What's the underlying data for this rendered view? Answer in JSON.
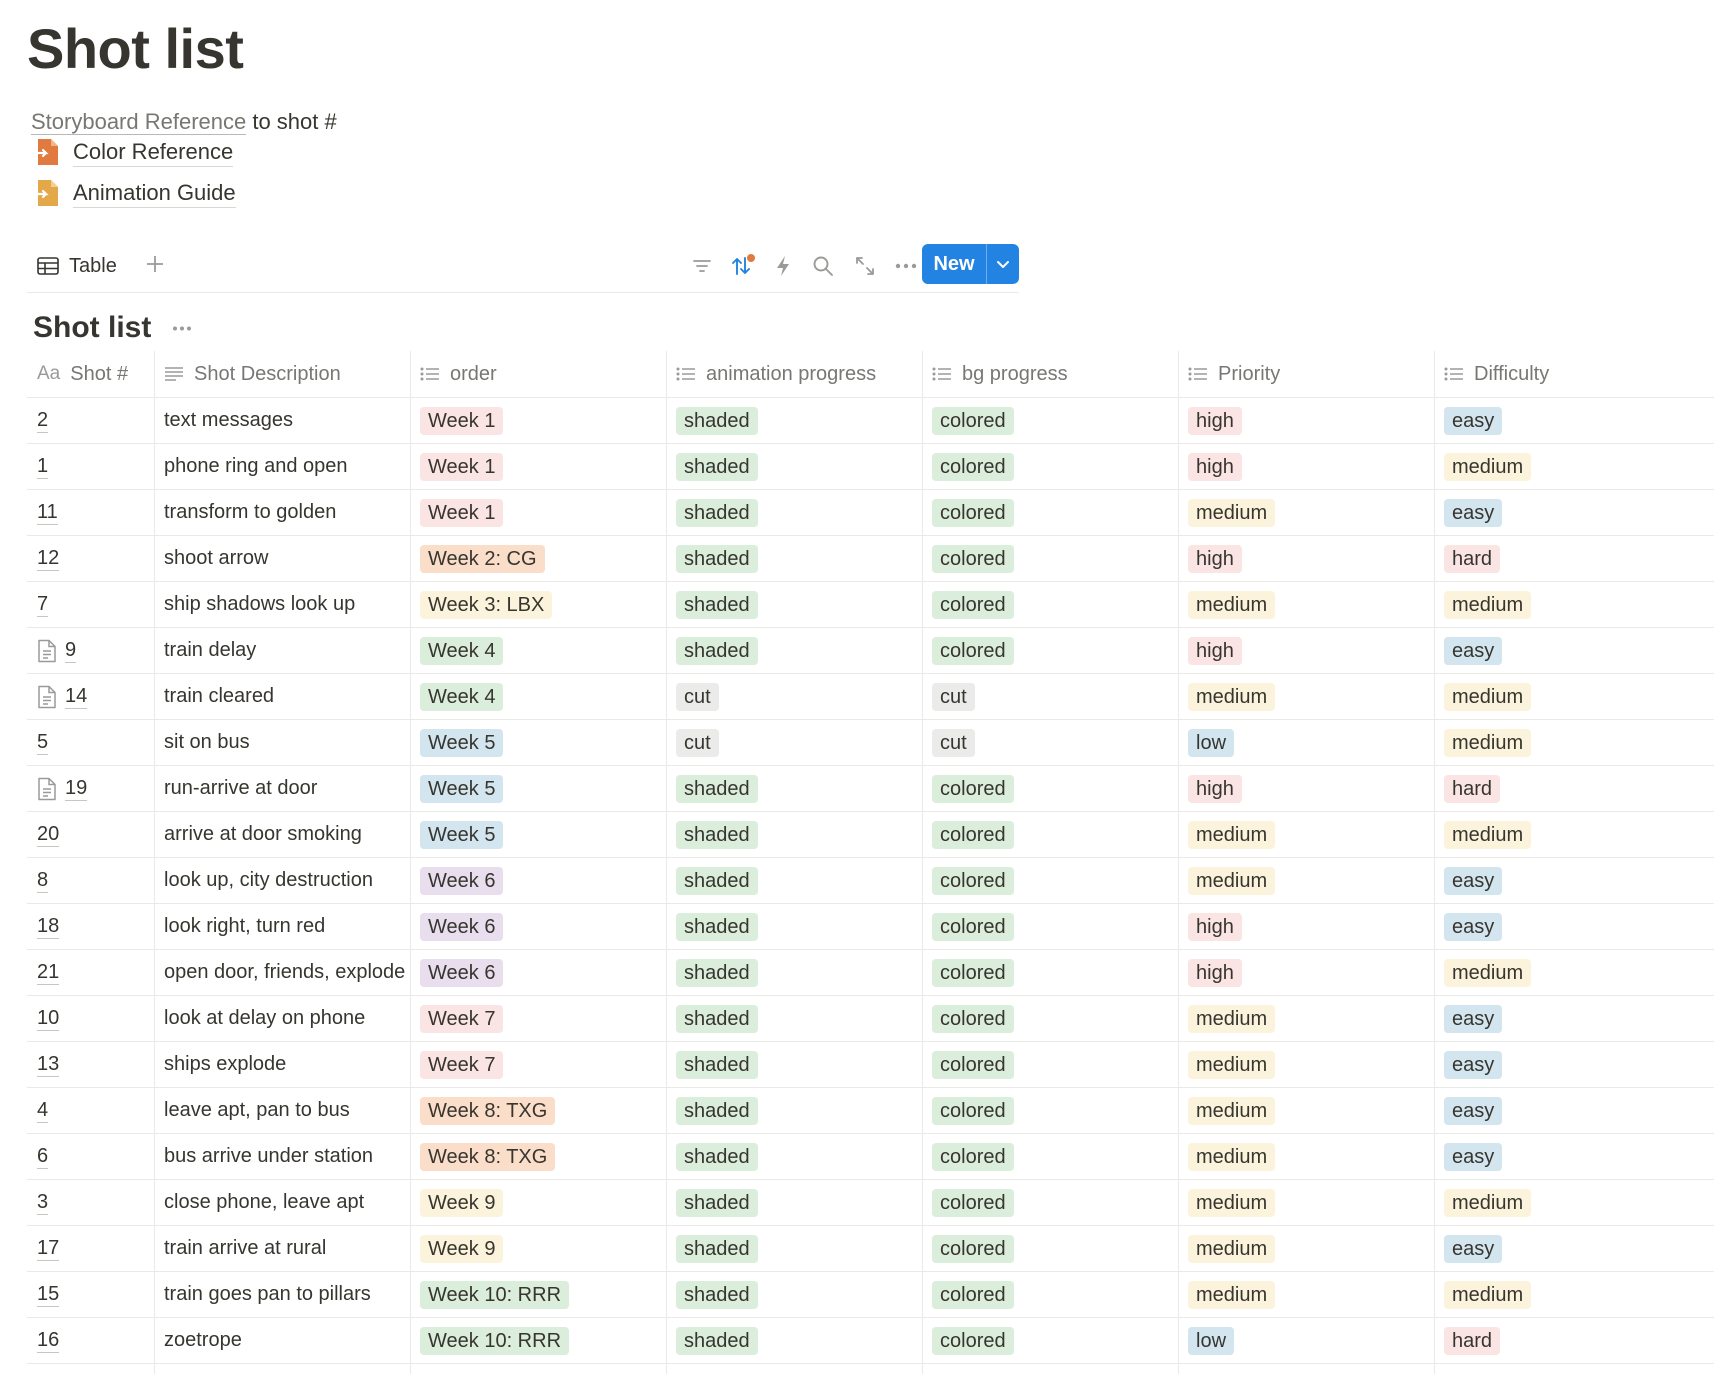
{
  "page": {
    "title": "Shot list"
  },
  "intro": {
    "link_text": "Storyboard Reference",
    "rest_text": " to shot #"
  },
  "page_links": [
    {
      "label": "Color Reference",
      "icon": "document-arrow-icon"
    },
    {
      "label": "Animation Guide",
      "icon": "document-arrow-icon"
    }
  ],
  "view": {
    "tab_label": "Table",
    "new_label": "New"
  },
  "database": {
    "title": "Shot list"
  },
  "colors": {
    "accent": "#2383e2",
    "red": "#fbe4e4",
    "orange": "#fadec9",
    "yellow": "#fbf3db",
    "green": "#dbeddb",
    "blue": "#d3e5ef",
    "purple": "#e8deee",
    "gray": "#ebebea",
    "sort_dot": "#e07a3e",
    "doc_icon": "#e07a3e"
  },
  "columns": [
    {
      "key": "shot",
      "label": "Shot #",
      "icon": "title-aa-icon"
    },
    {
      "key": "desc",
      "label": "Shot Description",
      "icon": "text-lines-icon"
    },
    {
      "key": "order",
      "label": "order",
      "icon": "list-icon"
    },
    {
      "key": "anim",
      "label": "animation progress",
      "icon": "list-icon"
    },
    {
      "key": "bg",
      "label": "bg progress",
      "icon": "list-icon"
    },
    {
      "key": "priority",
      "label": "Priority",
      "icon": "list-icon"
    },
    {
      "key": "difficulty",
      "label": "Difficulty",
      "icon": "list-icon"
    }
  ],
  "title_icon_text": "Aa",
  "rows": [
    {
      "shot": "2",
      "page": false,
      "desc": "text messages",
      "order": [
        "Week 1",
        "red"
      ],
      "anim": [
        "shaded",
        "green"
      ],
      "bg": [
        "colored",
        "green"
      ],
      "priority": [
        "high",
        "red"
      ],
      "difficulty": [
        "easy",
        "blue"
      ]
    },
    {
      "shot": "1",
      "page": false,
      "desc": "phone ring and open",
      "order": [
        "Week 1",
        "red"
      ],
      "anim": [
        "shaded",
        "green"
      ],
      "bg": [
        "colored",
        "green"
      ],
      "priority": [
        "high",
        "red"
      ],
      "difficulty": [
        "medium",
        "yellow"
      ]
    },
    {
      "shot": "11",
      "page": false,
      "desc": "transform to golden",
      "order": [
        "Week 1",
        "red"
      ],
      "anim": [
        "shaded",
        "green"
      ],
      "bg": [
        "colored",
        "green"
      ],
      "priority": [
        "medium",
        "yellow"
      ],
      "difficulty": [
        "easy",
        "blue"
      ]
    },
    {
      "shot": "12",
      "page": false,
      "desc": "shoot arrow",
      "order": [
        "Week 2: CG",
        "orange"
      ],
      "anim": [
        "shaded",
        "green"
      ],
      "bg": [
        "colored",
        "green"
      ],
      "priority": [
        "high",
        "red"
      ],
      "difficulty": [
        "hard",
        "red"
      ]
    },
    {
      "shot": "7",
      "page": false,
      "desc": "ship shadows look up",
      "order": [
        "Week 3: LBX",
        "yellow"
      ],
      "anim": [
        "shaded",
        "green"
      ],
      "bg": [
        "colored",
        "green"
      ],
      "priority": [
        "medium",
        "yellow"
      ],
      "difficulty": [
        "medium",
        "yellow"
      ]
    },
    {
      "shot": "9",
      "page": true,
      "desc": "train delay",
      "order": [
        "Week 4",
        "green"
      ],
      "anim": [
        "shaded",
        "green"
      ],
      "bg": [
        "colored",
        "green"
      ],
      "priority": [
        "high",
        "red"
      ],
      "difficulty": [
        "easy",
        "blue"
      ]
    },
    {
      "shot": "14",
      "page": true,
      "desc": "train cleared",
      "order": [
        "Week 4",
        "green"
      ],
      "anim": [
        "cut",
        "gray"
      ],
      "bg": [
        "cut",
        "gray"
      ],
      "priority": [
        "medium",
        "yellow"
      ],
      "difficulty": [
        "medium",
        "yellow"
      ]
    },
    {
      "shot": "5",
      "page": false,
      "desc": "sit on bus",
      "order": [
        "Week 5",
        "blue"
      ],
      "anim": [
        "cut",
        "gray"
      ],
      "bg": [
        "cut",
        "gray"
      ],
      "priority": [
        "low",
        "blue"
      ],
      "difficulty": [
        "medium",
        "yellow"
      ]
    },
    {
      "shot": "19",
      "page": true,
      "desc": "run-arrive at door",
      "order": [
        "Week 5",
        "blue"
      ],
      "anim": [
        "shaded",
        "green"
      ],
      "bg": [
        "colored",
        "green"
      ],
      "priority": [
        "high",
        "red"
      ],
      "difficulty": [
        "hard",
        "red"
      ]
    },
    {
      "shot": "20",
      "page": false,
      "desc": "arrive at door smoking",
      "order": [
        "Week 5",
        "blue"
      ],
      "anim": [
        "shaded",
        "green"
      ],
      "bg": [
        "colored",
        "green"
      ],
      "priority": [
        "medium",
        "yellow"
      ],
      "difficulty": [
        "medium",
        "yellow"
      ]
    },
    {
      "shot": "8",
      "page": false,
      "desc": "look up, city destruction",
      "order": [
        "Week 6",
        "purple"
      ],
      "anim": [
        "shaded",
        "green"
      ],
      "bg": [
        "colored",
        "green"
      ],
      "priority": [
        "medium",
        "yellow"
      ],
      "difficulty": [
        "easy",
        "blue"
      ]
    },
    {
      "shot": "18",
      "page": false,
      "desc": "look right, turn red",
      "order": [
        "Week 6",
        "purple"
      ],
      "anim": [
        "shaded",
        "green"
      ],
      "bg": [
        "colored",
        "green"
      ],
      "priority": [
        "high",
        "red"
      ],
      "difficulty": [
        "easy",
        "blue"
      ]
    },
    {
      "shot": "21",
      "page": false,
      "desc": "open door, friends, explode",
      "order": [
        "Week 6",
        "purple"
      ],
      "anim": [
        "shaded",
        "green"
      ],
      "bg": [
        "colored",
        "green"
      ],
      "priority": [
        "high",
        "red"
      ],
      "difficulty": [
        "medium",
        "yellow"
      ]
    },
    {
      "shot": "10",
      "page": false,
      "desc": "look at delay on phone",
      "order": [
        "Week 7",
        "red"
      ],
      "anim": [
        "shaded",
        "green"
      ],
      "bg": [
        "colored",
        "green"
      ],
      "priority": [
        "medium",
        "yellow"
      ],
      "difficulty": [
        "easy",
        "blue"
      ]
    },
    {
      "shot": "13",
      "page": false,
      "desc": "ships explode",
      "order": [
        "Week 7",
        "red"
      ],
      "anim": [
        "shaded",
        "green"
      ],
      "bg": [
        "colored",
        "green"
      ],
      "priority": [
        "medium",
        "yellow"
      ],
      "difficulty": [
        "easy",
        "blue"
      ]
    },
    {
      "shot": "4",
      "page": false,
      "desc": "leave apt, pan to bus",
      "order": [
        "Week 8: TXG",
        "orange"
      ],
      "anim": [
        "shaded",
        "green"
      ],
      "bg": [
        "colored",
        "green"
      ],
      "priority": [
        "medium",
        "yellow"
      ],
      "difficulty": [
        "easy",
        "blue"
      ]
    },
    {
      "shot": "6",
      "page": false,
      "desc": "bus arrive under station",
      "order": [
        "Week 8: TXG",
        "orange"
      ],
      "anim": [
        "shaded",
        "green"
      ],
      "bg": [
        "colored",
        "green"
      ],
      "priority": [
        "medium",
        "yellow"
      ],
      "difficulty": [
        "easy",
        "blue"
      ]
    },
    {
      "shot": "3",
      "page": false,
      "desc": "close phone, leave apt",
      "order": [
        "Week 9",
        "yellow"
      ],
      "anim": [
        "shaded",
        "green"
      ],
      "bg": [
        "colored",
        "green"
      ],
      "priority": [
        "medium",
        "yellow"
      ],
      "difficulty": [
        "medium",
        "yellow"
      ]
    },
    {
      "shot": "17",
      "page": false,
      "desc": "train arrive at rural",
      "order": [
        "Week 9",
        "yellow"
      ],
      "anim": [
        "shaded",
        "green"
      ],
      "bg": [
        "colored",
        "green"
      ],
      "priority": [
        "medium",
        "yellow"
      ],
      "difficulty": [
        "easy",
        "blue"
      ]
    },
    {
      "shot": "15",
      "page": false,
      "desc": "train goes pan to pillars",
      "order": [
        "Week 10: RRR",
        "green"
      ],
      "anim": [
        "shaded",
        "green"
      ],
      "bg": [
        "colored",
        "green"
      ],
      "priority": [
        "medium",
        "yellow"
      ],
      "difficulty": [
        "medium",
        "yellow"
      ]
    },
    {
      "shot": "16",
      "page": false,
      "desc": "zoetrope",
      "order": [
        "Week 10: RRR",
        "green"
      ],
      "anim": [
        "shaded",
        "green"
      ],
      "bg": [
        "colored",
        "green"
      ],
      "priority": [
        "low",
        "blue"
      ],
      "difficulty": [
        "hard",
        "red"
      ]
    }
  ]
}
